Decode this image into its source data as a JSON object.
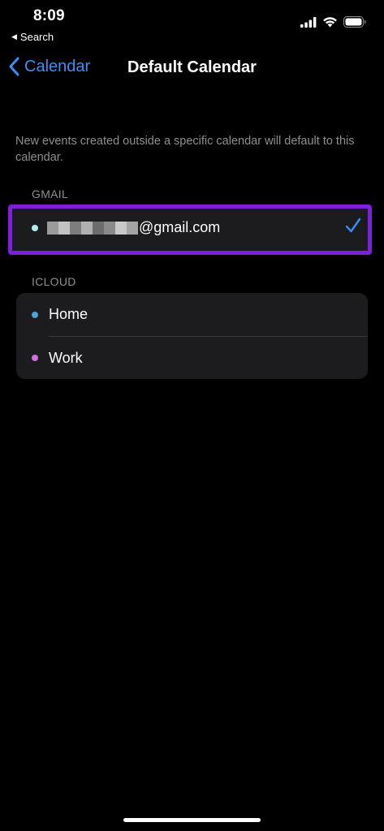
{
  "status_bar": {
    "time": "8:09",
    "back_app": "Search"
  },
  "nav": {
    "back_label": "Calendar",
    "title": "Default Calendar"
  },
  "description": "New events created outside a specific calendar will default to this calendar.",
  "sections": {
    "gmail": {
      "header": "GMAIL",
      "account_suffix": "@gmail.com",
      "dot_color": "#b3e9f2",
      "selected": true
    },
    "icloud": {
      "header": "ICLOUD",
      "items": [
        {
          "label": "Home",
          "dot_color": "#4aa3d9"
        },
        {
          "label": "Work",
          "dot_color": "#d46ee0"
        }
      ]
    }
  },
  "colors": {
    "accent": "#3a8ff7",
    "highlight_border": "#7e1fd9"
  }
}
